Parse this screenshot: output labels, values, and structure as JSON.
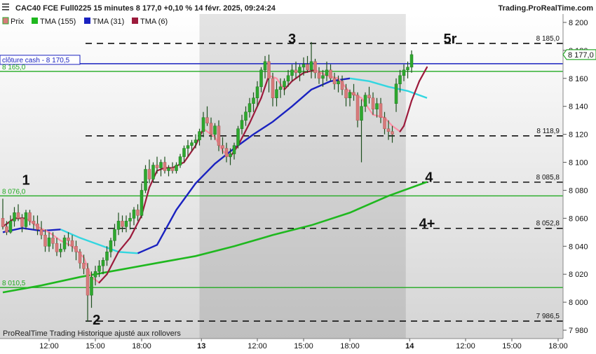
{
  "header": {
    "title": "CAC40 FCE Full0225 15 minutes 8 177,0 +0,10 % 14 févr. 2025, 09:24:24",
    "brand": "Trading.ProRealTime.com"
  },
  "legend": [
    {
      "label": "Prix",
      "color": "#d77b7b"
    },
    {
      "label": "TMA (155)",
      "color": "#1fb81f"
    },
    {
      "label": "TMA (31)",
      "color": "#1a22c0"
    },
    {
      "label": "TMA (6)",
      "color": "#9c1b3c"
    }
  ],
  "footer_note": "ProRealTime Trading  Historique ajusté aux rollovers",
  "colors": {
    "up": "#2ea82e",
    "down": "#d77b7b",
    "wick": "#1e4f1e",
    "tma155": "#1fb81f",
    "tma31_a": "#1a22c0",
    "tma31_b": "#33d6e0",
    "tma6_a": "#9c1b3c",
    "tma6_b": "#ff8fa6",
    "cash": "#1a22c0",
    "support": "#22aa22"
  },
  "annotations": [
    {
      "text": "1",
      "x": 6,
      "y": 8084
    },
    {
      "text": "2",
      "x": 24.3,
      "y": 7984
    },
    {
      "text": "3",
      "x": 75,
      "y": 8185
    },
    {
      "text": "5r",
      "x": 116,
      "y": 8185
    },
    {
      "text": "4",
      "x": 110.5,
      "y": 8086
    },
    {
      "text": "4+",
      "x": 110,
      "y": 8053
    }
  ],
  "chart_data": {
    "type": "candlestick",
    "title": "CAC40 FCE Full0225 15 minutes",
    "ylim": [
      7974,
      8206
    ],
    "y_ticks": [
      {
        "value": 8200,
        "label": "8 200"
      },
      {
        "value": 8180,
        "label": "8 180"
      },
      {
        "value": 8160,
        "label": "8 160"
      },
      {
        "value": 8140,
        "label": "8 140"
      },
      {
        "value": 8120,
        "label": "8 120"
      },
      {
        "value": 8100,
        "label": "8 100"
      },
      {
        "value": 8080,
        "label": "8 080"
      },
      {
        "value": 8060,
        "label": "8 060"
      },
      {
        "value": 8040,
        "label": "8 040"
      },
      {
        "value": 8020,
        "label": "8 020"
      },
      {
        "value": 8000,
        "label": "8 000"
      },
      {
        "value": 7980,
        "label": "7 980"
      }
    ],
    "x_ticks": [
      {
        "x": 12,
        "label": "12:00"
      },
      {
        "x": 24,
        "label": "15:00"
      },
      {
        "x": 36,
        "label": "18:00"
      },
      {
        "x": 51.5,
        "label": "13",
        "bold": true
      },
      {
        "x": 66,
        "label": "12:00"
      },
      {
        "x": 78,
        "label": "15:00"
      },
      {
        "x": 90,
        "label": "18:00"
      },
      {
        "x": 105.5,
        "label": "14",
        "bold": true
      },
      {
        "x": 120,
        "label": "12:00"
      },
      {
        "x": 132,
        "label": "15:00"
      },
      {
        "x": 144,
        "label": "18:00"
      }
    ],
    "shaded_bands": [
      {
        "from": 51,
        "to": 104.5
      }
    ],
    "last_price": {
      "value": 8177.0,
      "label": "8 177,0"
    },
    "horizontal_lines": [
      {
        "label": "8 185,0",
        "value": 8185.0,
        "style": "dashed"
      },
      {
        "label": "8 118,9",
        "value": 8118.9,
        "style": "dashed"
      },
      {
        "label": "8 085,8",
        "value": 8085.8,
        "style": "dashed"
      },
      {
        "label": "8 052,8",
        "value": 8052.8,
        "style": "dashed"
      },
      {
        "label": "7 986,5",
        "value": 7986.5,
        "style": "dashed"
      },
      {
        "label": "clôture cash -  8 170,5",
        "value": 8170.5,
        "style": "cash"
      },
      {
        "label": "8 165,0",
        "value": 8165.0,
        "style": "support"
      },
      {
        "label": "8 076,0",
        "value": 8076.0,
        "style": "support"
      },
      {
        "label": "8 010,5",
        "value": 8010.5,
        "style": "support"
      }
    ],
    "candles": [
      [
        8060,
        8074,
        8052,
        8054
      ],
      [
        8054,
        8058,
        8048,
        8050
      ],
      [
        8050,
        8062,
        8049,
        8058
      ],
      [
        8058,
        8068,
        8054,
        8064
      ],
      [
        8064,
        8070,
        8058,
        8060
      ],
      [
        8060,
        8063,
        8050,
        8054
      ],
      [
        8054,
        8066,
        8052,
        8064
      ],
      [
        8064,
        8066,
        8055,
        8058
      ],
      [
        8058,
        8062,
        8052,
        8056
      ],
      [
        8056,
        8062,
        8048,
        8052
      ],
      [
        8052,
        8058,
        8045,
        8048
      ],
      [
        8048,
        8052,
        8036,
        8040
      ],
      [
        8040,
        8050,
        8036,
        8046
      ],
      [
        8046,
        8050,
        8038,
        8042
      ],
      [
        8042,
        8046,
        8033,
        8036
      ],
      [
        8036,
        8042,
        8032,
        8038
      ],
      [
        8038,
        8048,
        8036,
        8046
      ],
      [
        8046,
        8050,
        8040,
        8044
      ],
      [
        8044,
        8048,
        8036,
        8040
      ],
      [
        8040,
        8044,
        8030,
        8036
      ],
      [
        8036,
        8038,
        8024,
        8028
      ],
      [
        8028,
        8034,
        8020,
        8024
      ],
      [
        8024,
        8028,
        7986,
        8005
      ],
      [
        8005,
        8022,
        7996,
        8018
      ],
      [
        8018,
        8026,
        8012,
        8022
      ],
      [
        8022,
        8030,
        8018,
        8026
      ],
      [
        8026,
        8032,
        8020,
        8030
      ],
      [
        8030,
        8040,
        8026,
        8036
      ],
      [
        8036,
        8046,
        8032,
        8044
      ],
      [
        8044,
        8056,
        8040,
        8052
      ],
      [
        8052,
        8064,
        8048,
        8058
      ],
      [
        8058,
        8062,
        8050,
        8054
      ],
      [
        8054,
        8062,
        8050,
        8058
      ],
      [
        8058,
        8064,
        8052,
        8060
      ],
      [
        8060,
        8068,
        8055,
        8066
      ],
      [
        8066,
        8070,
        8058,
        8062
      ],
      [
        8062,
        8085,
        8060,
        8080
      ],
      [
        8080,
        8098,
        8078,
        8095
      ],
      [
        8095,
        8102,
        8085,
        8088
      ],
      [
        8088,
        8100,
        8086,
        8098
      ],
      [
        8098,
        8104,
        8092,
        8096
      ],
      [
        8096,
        8102,
        8090,
        8100
      ],
      [
        8100,
        8104,
        8092,
        8094
      ],
      [
        8094,
        8098,
        8090,
        8096
      ],
      [
        8096,
        8100,
        8092,
        8094
      ],
      [
        8094,
        8100,
        8092,
        8098
      ],
      [
        8098,
        8106,
        8096,
        8104
      ],
      [
        8104,
        8112,
        8100,
        8110
      ],
      [
        8110,
        8116,
        8104,
        8112
      ],
      [
        8112,
        8116,
        8108,
        8114
      ],
      [
        8114,
        8120,
        8110,
        8116
      ],
      [
        8116,
        8124,
        8112,
        8122
      ],
      [
        8122,
        8136,
        8118,
        8132
      ],
      [
        8132,
        8140,
        8126,
        8128
      ],
      [
        8128,
        8132,
        8116,
        8120
      ],
      [
        8120,
        8128,
        8116,
        8126
      ],
      [
        8126,
        8130,
        8108,
        8112
      ],
      [
        8112,
        8118,
        8106,
        8110
      ],
      [
        8110,
        8114,
        8100,
        8104
      ],
      [
        8104,
        8110,
        8098,
        8106
      ],
      [
        8106,
        8114,
        8102,
        8112
      ],
      [
        8112,
        8126,
        8110,
        8124
      ],
      [
        8124,
        8134,
        8120,
        8130
      ],
      [
        8130,
        8140,
        8126,
        8136
      ],
      [
        8136,
        8146,
        8132,
        8142
      ],
      [
        8142,
        8150,
        8136,
        8146
      ],
      [
        8146,
        8158,
        8140,
        8154
      ],
      [
        8154,
        8168,
        8150,
        8166
      ],
      [
        8166,
        8176,
        8160,
        8172
      ],
      [
        8172,
        8177,
        8150,
        8160
      ],
      [
        8160,
        8164,
        8140,
        8146
      ],
      [
        8146,
        8158,
        8140,
        8152
      ],
      [
        8152,
        8160,
        8146,
        8154
      ],
      [
        8154,
        8160,
        8148,
        8158
      ],
      [
        8158,
        8166,
        8154,
        8162
      ],
      [
        8162,
        8170,
        8158,
        8166
      ],
      [
        8166,
        8172,
        8160,
        8164
      ],
      [
        8164,
        8170,
        8158,
        8168
      ],
      [
        8168,
        8175,
        8162,
        8170
      ],
      [
        8170,
        8176,
        8164,
        8166
      ],
      [
        8166,
        8186,
        8160,
        8172
      ],
      [
        8172,
        8174,
        8160,
        8164
      ],
      [
        8164,
        8168,
        8156,
        8160
      ],
      [
        8160,
        8166,
        8154,
        8162
      ],
      [
        8162,
        8172,
        8158,
        8166
      ],
      [
        8166,
        8170,
        8158,
        8160
      ],
      [
        8160,
        8164,
        8152,
        8156
      ],
      [
        8156,
        8162,
        8150,
        8158
      ],
      [
        8158,
        8162,
        8148,
        8152
      ],
      [
        8152,
        8156,
        8140,
        8146
      ],
      [
        8146,
        8152,
        8140,
        8150
      ],
      [
        8150,
        8156,
        8144,
        8148
      ],
      [
        8148,
        8150,
        8125,
        8130
      ],
      [
        8130,
        8145,
        8100,
        8140
      ],
      [
        8140,
        8150,
        8136,
        8148
      ],
      [
        8148,
        8154,
        8142,
        8146
      ],
      [
        8146,
        8150,
        8134,
        8138
      ],
      [
        8138,
        8146,
        8132,
        8142
      ],
      [
        8142,
        8146,
        8128,
        8132
      ],
      [
        8132,
        8136,
        8120,
        8124
      ],
      [
        8124,
        8130,
        8116,
        8122
      ],
      [
        8122,
        8126,
        8114,
        8120
      ],
      [
        8142,
        8160,
        8136,
        8156
      ],
      [
        8156,
        8166,
        8150,
        8162
      ],
      [
        8162,
        8170,
        8158,
        8166
      ],
      [
        8166,
        8172,
        8160,
        8168
      ],
      [
        8168,
        8180,
        8164,
        8177
      ]
    ],
    "series": [
      {
        "name": "TMA (155)",
        "points": [
          [
            0,
            8007
          ],
          [
            10,
            8012
          ],
          [
            20,
            8018
          ],
          [
            30,
            8023
          ],
          [
            40,
            8028
          ],
          [
            50,
            8033
          ],
          [
            60,
            8040
          ],
          [
            70,
            8048
          ],
          [
            80,
            8055
          ],
          [
            90,
            8064
          ],
          [
            100,
            8076
          ],
          [
            110,
            8086
          ]
        ]
      },
      {
        "name": "TMA (31)",
        "points": [
          [
            0,
            8050
          ],
          [
            5,
            8053
          ],
          [
            10,
            8051
          ],
          [
            15,
            8052
          ],
          [
            20,
            8046
          ],
          [
            25,
            8041
          ],
          [
            30,
            8036
          ],
          [
            35,
            8035
          ],
          [
            40,
            8041
          ],
          [
            45,
            8066
          ],
          [
            50,
            8085
          ],
          [
            55,
            8099
          ],
          [
            60,
            8110
          ],
          [
            65,
            8120
          ],
          [
            70,
            8129
          ],
          [
            75,
            8140
          ],
          [
            80,
            8152
          ],
          [
            85,
            8158
          ],
          [
            90,
            8160
          ],
          [
            95,
            8158
          ],
          [
            100,
            8154
          ],
          [
            105,
            8151
          ],
          [
            110,
            8146
          ]
        ]
      },
      {
        "name": "TMA (6)",
        "points": [
          [
            0,
            8054
          ],
          [
            3,
            8060
          ],
          [
            6,
            8060
          ],
          [
            9,
            8054
          ],
          [
            12,
            8050
          ],
          [
            15,
            8044
          ],
          [
            18,
            8040
          ],
          [
            21,
            8032
          ],
          [
            23,
            8018
          ],
          [
            25,
            8014
          ],
          [
            27,
            8020
          ],
          [
            30,
            8036
          ],
          [
            33,
            8046
          ],
          [
            36,
            8062
          ],
          [
            38,
            8082
          ],
          [
            40,
            8094
          ],
          [
            42,
            8096
          ],
          [
            44,
            8096
          ],
          [
            47,
            8100
          ],
          [
            50,
            8112
          ],
          [
            52,
            8124
          ],
          [
            55,
            8118
          ],
          [
            57,
            8108
          ],
          [
            59,
            8104
          ],
          [
            61,
            8112
          ],
          [
            64,
            8128
          ],
          [
            67,
            8146
          ],
          [
            69,
            8162
          ],
          [
            71,
            8160
          ],
          [
            73,
            8152
          ],
          [
            75,
            8158
          ],
          [
            78,
            8164
          ],
          [
            81,
            8166
          ],
          [
            84,
            8162
          ],
          [
            87,
            8160
          ],
          [
            90,
            8150
          ],
          [
            93,
            8146
          ],
          [
            96,
            8134
          ],
          [
            99,
            8132
          ],
          [
            101,
            8126
          ],
          [
            103,
            8122
          ],
          [
            104,
            8126
          ],
          [
            106,
            8144
          ],
          [
            108,
            8158
          ],
          [
            110,
            8168
          ]
        ]
      }
    ]
  }
}
